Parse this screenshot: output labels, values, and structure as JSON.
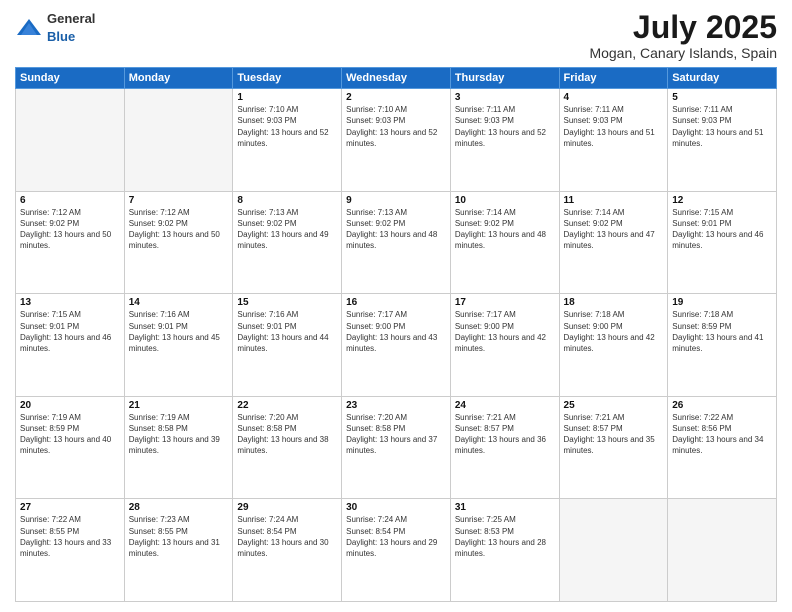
{
  "header": {
    "logo_general": "General",
    "logo_blue": "Blue",
    "month": "July 2025",
    "location": "Mogan, Canary Islands, Spain"
  },
  "days_of_week": [
    "Sunday",
    "Monday",
    "Tuesday",
    "Wednesday",
    "Thursday",
    "Friday",
    "Saturday"
  ],
  "weeks": [
    [
      {
        "day": "",
        "info": ""
      },
      {
        "day": "",
        "info": ""
      },
      {
        "day": "1",
        "info": "Sunrise: 7:10 AM\nSunset: 9:03 PM\nDaylight: 13 hours and 52 minutes."
      },
      {
        "day": "2",
        "info": "Sunrise: 7:10 AM\nSunset: 9:03 PM\nDaylight: 13 hours and 52 minutes."
      },
      {
        "day": "3",
        "info": "Sunrise: 7:11 AM\nSunset: 9:03 PM\nDaylight: 13 hours and 52 minutes."
      },
      {
        "day": "4",
        "info": "Sunrise: 7:11 AM\nSunset: 9:03 PM\nDaylight: 13 hours and 51 minutes."
      },
      {
        "day": "5",
        "info": "Sunrise: 7:11 AM\nSunset: 9:03 PM\nDaylight: 13 hours and 51 minutes."
      }
    ],
    [
      {
        "day": "6",
        "info": "Sunrise: 7:12 AM\nSunset: 9:02 PM\nDaylight: 13 hours and 50 minutes."
      },
      {
        "day": "7",
        "info": "Sunrise: 7:12 AM\nSunset: 9:02 PM\nDaylight: 13 hours and 50 minutes."
      },
      {
        "day": "8",
        "info": "Sunrise: 7:13 AM\nSunset: 9:02 PM\nDaylight: 13 hours and 49 minutes."
      },
      {
        "day": "9",
        "info": "Sunrise: 7:13 AM\nSunset: 9:02 PM\nDaylight: 13 hours and 48 minutes."
      },
      {
        "day": "10",
        "info": "Sunrise: 7:14 AM\nSunset: 9:02 PM\nDaylight: 13 hours and 48 minutes."
      },
      {
        "day": "11",
        "info": "Sunrise: 7:14 AM\nSunset: 9:02 PM\nDaylight: 13 hours and 47 minutes."
      },
      {
        "day": "12",
        "info": "Sunrise: 7:15 AM\nSunset: 9:01 PM\nDaylight: 13 hours and 46 minutes."
      }
    ],
    [
      {
        "day": "13",
        "info": "Sunrise: 7:15 AM\nSunset: 9:01 PM\nDaylight: 13 hours and 46 minutes."
      },
      {
        "day": "14",
        "info": "Sunrise: 7:16 AM\nSunset: 9:01 PM\nDaylight: 13 hours and 45 minutes."
      },
      {
        "day": "15",
        "info": "Sunrise: 7:16 AM\nSunset: 9:01 PM\nDaylight: 13 hours and 44 minutes."
      },
      {
        "day": "16",
        "info": "Sunrise: 7:17 AM\nSunset: 9:00 PM\nDaylight: 13 hours and 43 minutes."
      },
      {
        "day": "17",
        "info": "Sunrise: 7:17 AM\nSunset: 9:00 PM\nDaylight: 13 hours and 42 minutes."
      },
      {
        "day": "18",
        "info": "Sunrise: 7:18 AM\nSunset: 9:00 PM\nDaylight: 13 hours and 42 minutes."
      },
      {
        "day": "19",
        "info": "Sunrise: 7:18 AM\nSunset: 8:59 PM\nDaylight: 13 hours and 41 minutes."
      }
    ],
    [
      {
        "day": "20",
        "info": "Sunrise: 7:19 AM\nSunset: 8:59 PM\nDaylight: 13 hours and 40 minutes."
      },
      {
        "day": "21",
        "info": "Sunrise: 7:19 AM\nSunset: 8:58 PM\nDaylight: 13 hours and 39 minutes."
      },
      {
        "day": "22",
        "info": "Sunrise: 7:20 AM\nSunset: 8:58 PM\nDaylight: 13 hours and 38 minutes."
      },
      {
        "day": "23",
        "info": "Sunrise: 7:20 AM\nSunset: 8:58 PM\nDaylight: 13 hours and 37 minutes."
      },
      {
        "day": "24",
        "info": "Sunrise: 7:21 AM\nSunset: 8:57 PM\nDaylight: 13 hours and 36 minutes."
      },
      {
        "day": "25",
        "info": "Sunrise: 7:21 AM\nSunset: 8:57 PM\nDaylight: 13 hours and 35 minutes."
      },
      {
        "day": "26",
        "info": "Sunrise: 7:22 AM\nSunset: 8:56 PM\nDaylight: 13 hours and 34 minutes."
      }
    ],
    [
      {
        "day": "27",
        "info": "Sunrise: 7:22 AM\nSunset: 8:55 PM\nDaylight: 13 hours and 33 minutes."
      },
      {
        "day": "28",
        "info": "Sunrise: 7:23 AM\nSunset: 8:55 PM\nDaylight: 13 hours and 31 minutes."
      },
      {
        "day": "29",
        "info": "Sunrise: 7:24 AM\nSunset: 8:54 PM\nDaylight: 13 hours and 30 minutes."
      },
      {
        "day": "30",
        "info": "Sunrise: 7:24 AM\nSunset: 8:54 PM\nDaylight: 13 hours and 29 minutes."
      },
      {
        "day": "31",
        "info": "Sunrise: 7:25 AM\nSunset: 8:53 PM\nDaylight: 13 hours and 28 minutes."
      },
      {
        "day": "",
        "info": ""
      },
      {
        "day": "",
        "info": ""
      }
    ]
  ]
}
